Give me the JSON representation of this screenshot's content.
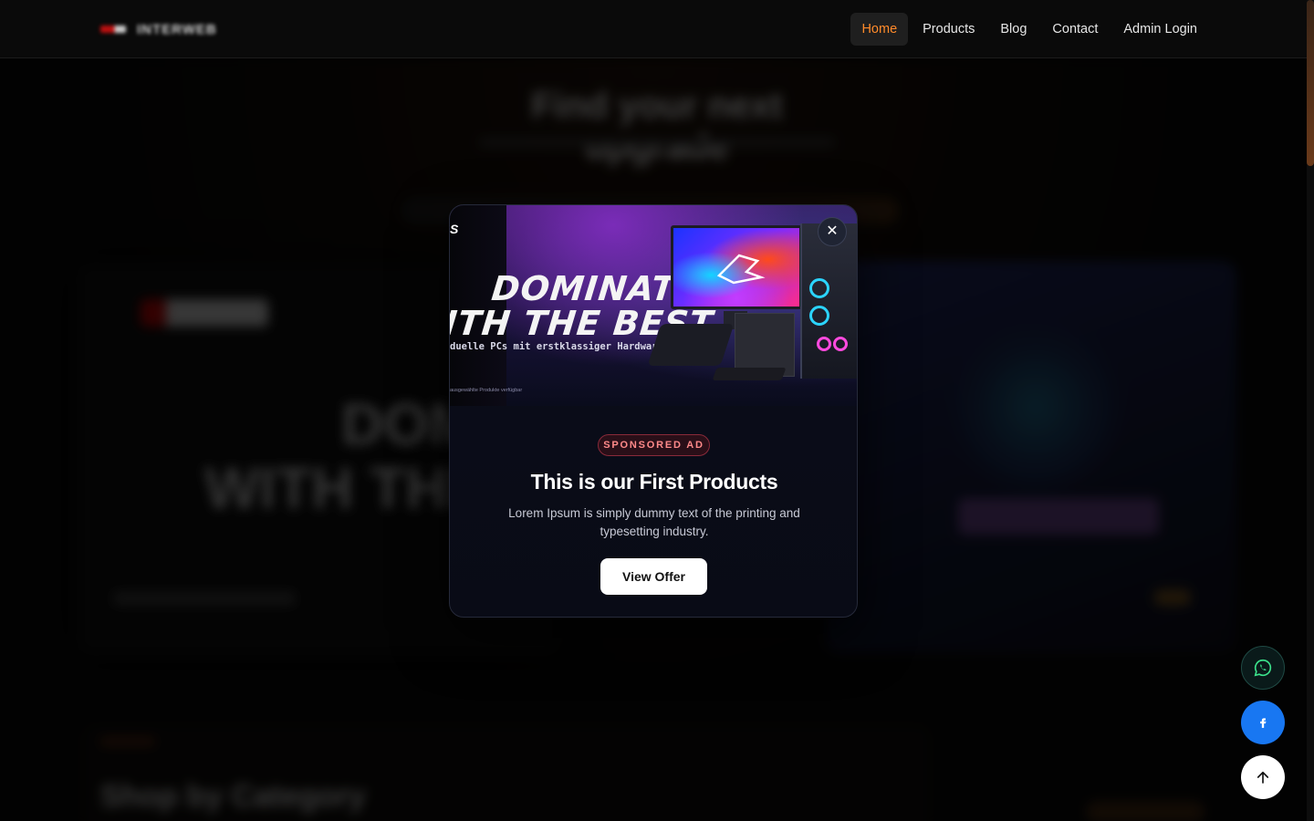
{
  "brand": {
    "name": "INTERWEB"
  },
  "nav": {
    "items": [
      {
        "label": "Home",
        "active": true
      },
      {
        "label": "Products",
        "active": false
      },
      {
        "label": "Blog",
        "active": false
      },
      {
        "label": "Contact",
        "active": false
      },
      {
        "label": "Admin Login",
        "active": false
      }
    ]
  },
  "background": {
    "hero_title": "Find your next upgrade",
    "card_left_line1": "DOM",
    "card_left_line2": "WITH THE",
    "section_title": "Shop by Category"
  },
  "modal": {
    "banner": {
      "logo_fragment": "S",
      "headline_1": "DOMINATE",
      "headline_2": "ITH THE BEST",
      "subline": "duelle PCs mit erstklassiger Hardware",
      "fineprint": "ausgewählte Produkte verfügbar"
    },
    "badge": "SPONSORED AD",
    "title": "This is our First Products",
    "description": "Lorem Ipsum is simply dummy text of the printing and typesetting industry.",
    "cta": "View Offer",
    "close_icon": "close-icon"
  },
  "floating": {
    "whatsapp_icon": "whatsapp-icon",
    "facebook_icon": "facebook-icon",
    "scroll_top_icon": "arrow-up-icon"
  },
  "colors": {
    "accent": "#ff8a2a",
    "facebook": "#1877f2",
    "badge_text": "#ff8a8a"
  }
}
